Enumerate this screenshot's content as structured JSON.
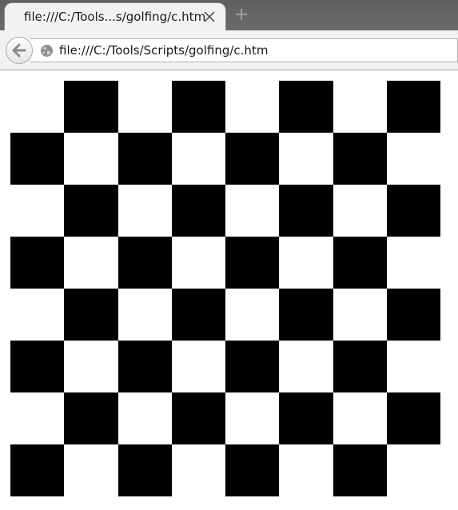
{
  "browser": {
    "tab": {
      "title": "file:///C:/Tools...s/golfing/c.htm",
      "close_icon": "close-icon"
    },
    "new_tab_icon": "plus-icon",
    "back_icon": "back-arrow-icon",
    "address": {
      "icon": "globe-icon",
      "url": "file:///C:/Tools/Scripts/golfing/c.htm"
    }
  },
  "page": {
    "board": {
      "rows": 8,
      "cols": 8,
      "colors": {
        "dark": "#000000",
        "light": "#ffffff"
      },
      "first_dark_row0_col": 1
    }
  }
}
